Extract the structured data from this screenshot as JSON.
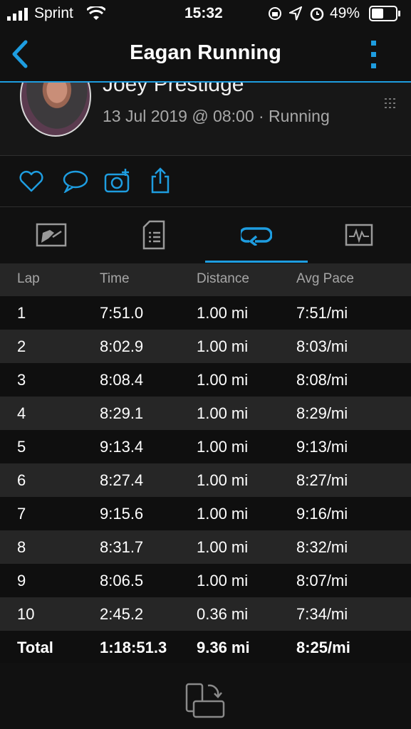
{
  "status_bar": {
    "carrier": "Sprint",
    "time": "15:32",
    "battery": "49%"
  },
  "nav": {
    "title": "Eagan Running"
  },
  "activity": {
    "user_name": "Joey Prestidge",
    "meta": "13 Jul 2019 @ 08:00 · Running"
  },
  "table": {
    "headers": {
      "lap": "Lap",
      "time": "Time",
      "distance": "Distance",
      "avg_pace": "Avg Pace"
    },
    "rows": [
      {
        "lap": "1",
        "time": "7:51.0",
        "distance": "1.00 mi",
        "pace": "7:51/mi"
      },
      {
        "lap": "2",
        "time": "8:02.9",
        "distance": "1.00 mi",
        "pace": "8:03/mi"
      },
      {
        "lap": "3",
        "time": "8:08.4",
        "distance": "1.00 mi",
        "pace": "8:08/mi"
      },
      {
        "lap": "4",
        "time": "8:29.1",
        "distance": "1.00 mi",
        "pace": "8:29/mi"
      },
      {
        "lap": "5",
        "time": "9:13.4",
        "distance": "1.00 mi",
        "pace": "9:13/mi"
      },
      {
        "lap": "6",
        "time": "8:27.4",
        "distance": "1.00 mi",
        "pace": "8:27/mi"
      },
      {
        "lap": "7",
        "time": "9:15.6",
        "distance": "1.00 mi",
        "pace": "9:16/mi"
      },
      {
        "lap": "8",
        "time": "8:31.7",
        "distance": "1.00 mi",
        "pace": "8:32/mi"
      },
      {
        "lap": "9",
        "time": "8:06.5",
        "distance": "1.00 mi",
        "pace": "8:07/mi"
      },
      {
        "lap": "10",
        "time": "2:45.2",
        "distance": "0.36 mi",
        "pace": "7:34/mi"
      }
    ],
    "total": {
      "lap": "Total",
      "time": "1:18:51.3",
      "distance": "9.36 mi",
      "pace": "8:25/mi"
    }
  },
  "icons": {
    "back": "chevron-left-icon",
    "menu": "more-vertical-icon",
    "like": "heart-icon",
    "comment": "comment-icon",
    "photo": "add-photo-icon",
    "share": "share-icon",
    "tab1": "stats-icon",
    "tab2": "details-icon",
    "tab3": "laps-icon",
    "tab4": "chart-icon",
    "rotate": "rotate-device-icon"
  },
  "colors": {
    "accent": "#1e9de0",
    "background": "#111111",
    "row_alt": "#262626"
  }
}
